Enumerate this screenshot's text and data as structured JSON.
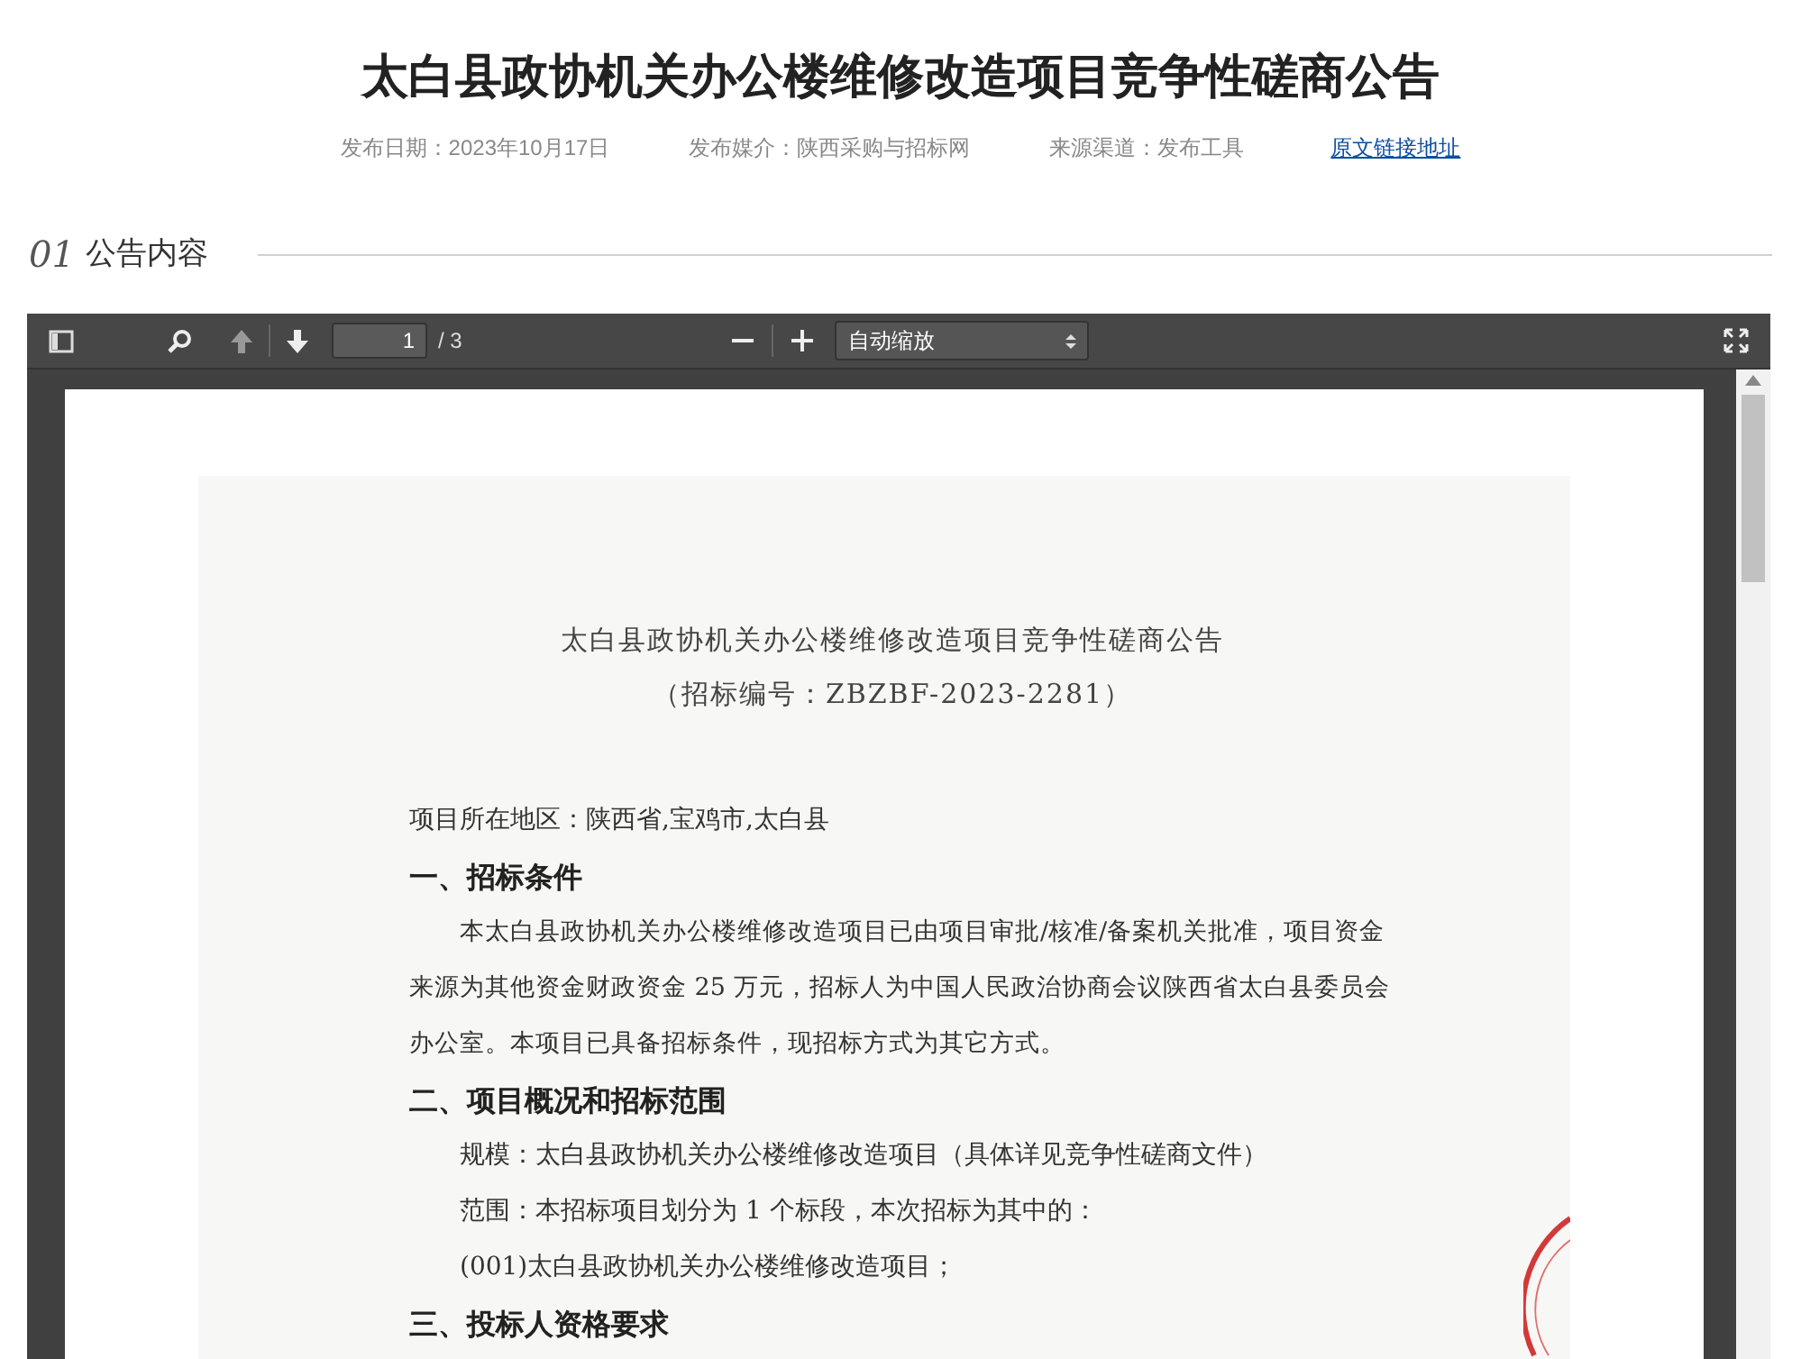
{
  "title": "太白县政协机关办公楼维修改造项目竞争性磋商公告",
  "meta": [
    {
      "kind": "text",
      "text": "发布日期：2023年10月17日"
    },
    {
      "kind": "text",
      "text": "发布媒介：陕西采购与招标网"
    },
    {
      "kind": "text",
      "text": "来源渠道：发布工具"
    },
    {
      "kind": "link",
      "text": "原文链接地址"
    }
  ],
  "section": {
    "number": "01",
    "label": "公告内容"
  },
  "viewer": {
    "page_input": "1",
    "page_total": "/ 3",
    "zoom": "自动缩放",
    "document": [
      {
        "kind": "title",
        "text": "太白县政协机关办公楼维修改造项目竞争性磋商公告"
      },
      {
        "kind": "title",
        "text": "（招标编号：ZBZBF-2023-2281）"
      },
      {
        "kind": "gap"
      },
      {
        "kind": "line",
        "text": "项目所在地区：陕西省,宝鸡市,太白县"
      },
      {
        "kind": "heading",
        "text": "一、招标条件"
      },
      {
        "kind": "paragraph",
        "text": "本太白县政协机关办公楼维修改造项目已由项目审批/核准/备案机关批准，项目资金来源为其他资金财政资金 25 万元，招标人为中国人民政治协商会议陕西省太白县委员会办公室。本项目已具备招标条件，现招标方式为其它方式。"
      },
      {
        "kind": "heading",
        "text": "二、项目概况和招标范围"
      },
      {
        "kind": "indented",
        "text": "规模：太白县政协机关办公楼维修改造项目（具体详见竞争性磋商文件）"
      },
      {
        "kind": "indented",
        "text": "范围：本招标项目划分为 1 个标段，本次招标为其中的："
      },
      {
        "kind": "indented",
        "text": "(001)太白县政协机关办公楼维修改造项目；"
      },
      {
        "kind": "heading",
        "text": "三、投标人资格要求"
      }
    ]
  }
}
